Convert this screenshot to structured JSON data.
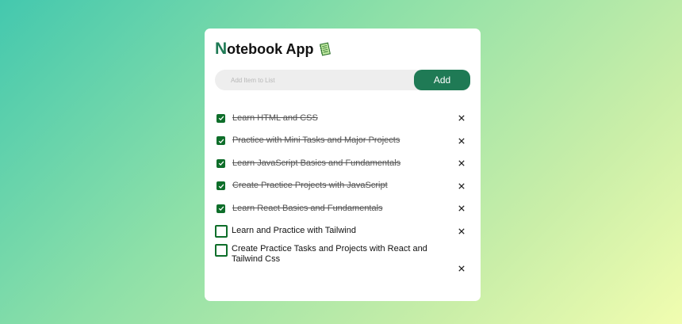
{
  "app": {
    "title_first_letter": "N",
    "title_rest": "otebook App",
    "title_icon": "notebook-icon"
  },
  "add_form": {
    "placeholder": "Add Item to List",
    "button_label": "Add"
  },
  "todos": [
    {
      "text": "Learn HTML and CSS",
      "done": true
    },
    {
      "text": "Practice with Mini Tasks and Major Projects",
      "done": true
    },
    {
      "text": "Learn JavaScript Basics and Fundamentals",
      "done": true
    },
    {
      "text": "Create Practice Projects with JavaScript",
      "done": true
    },
    {
      "text": "Learn React Basics and Fundamentals",
      "done": true
    },
    {
      "text": "Learn and Practice with Tailwind",
      "done": false
    },
    {
      "text": "Create Practice Tasks and Projects with React and Tailwind Css",
      "done": false
    }
  ],
  "colors": {
    "accent": "#1f7a55",
    "checkbox": "#0e6e2a",
    "card": "#ffffff"
  },
  "icons": {
    "check": "check-icon",
    "delete": "close-icon"
  }
}
